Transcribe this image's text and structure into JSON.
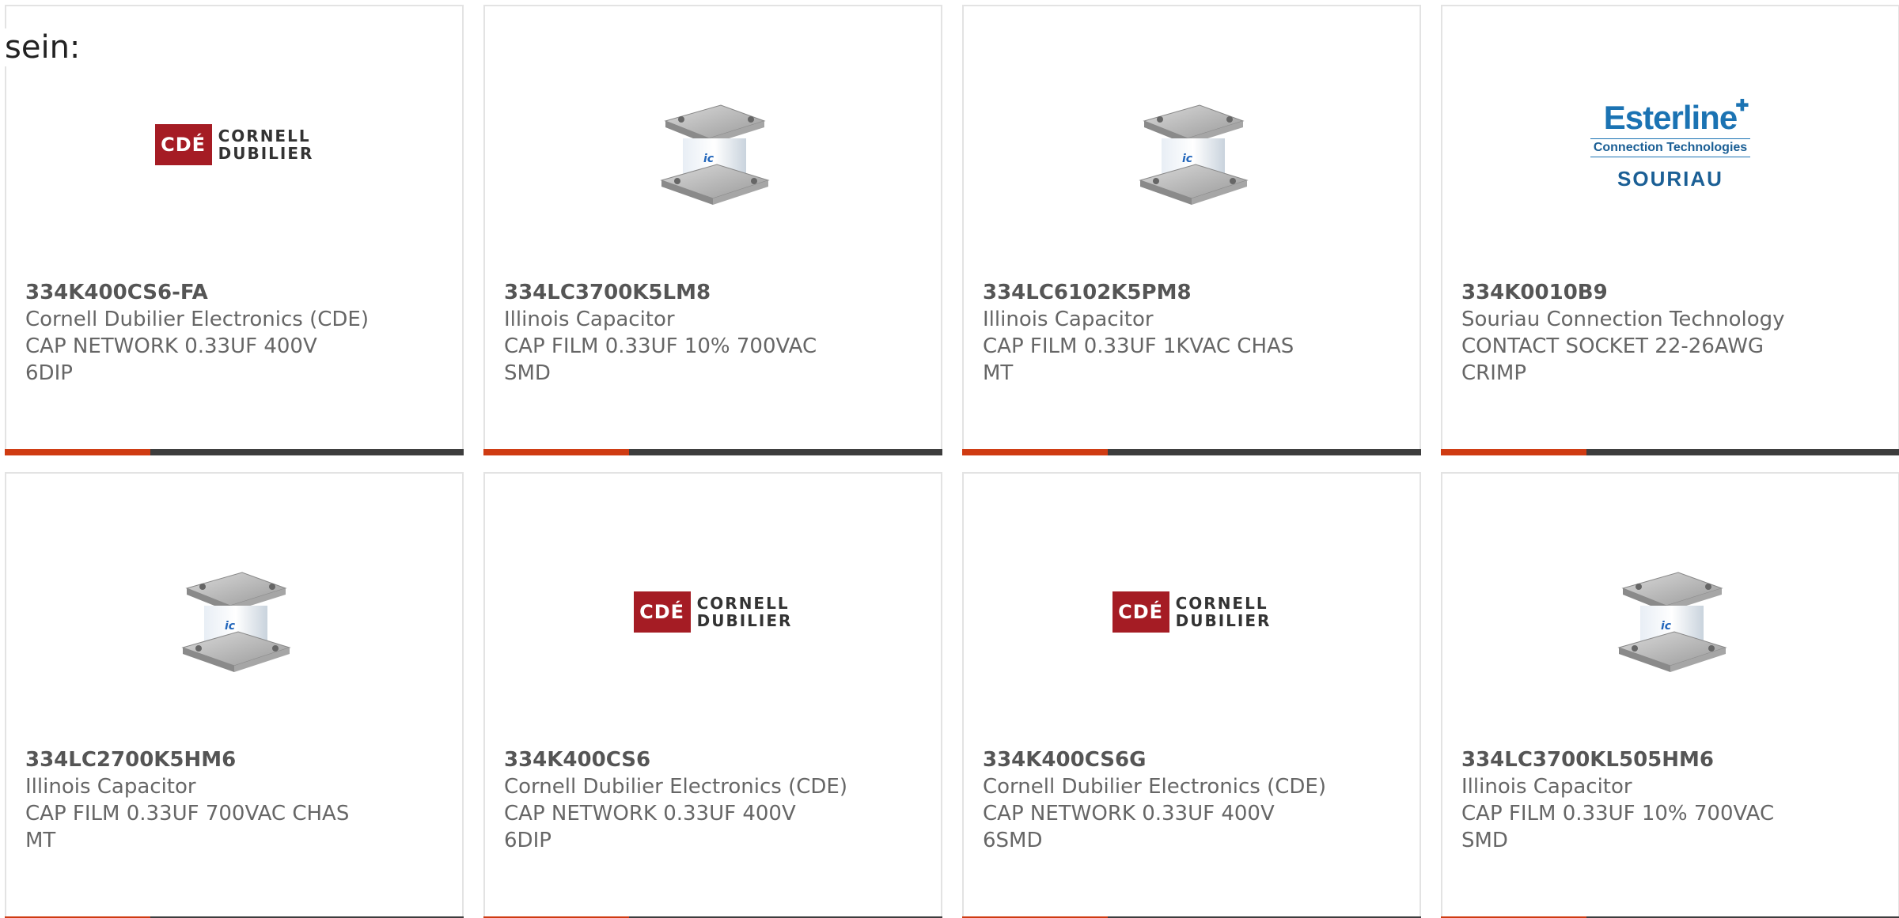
{
  "overlay_text": "sein:",
  "colors": {
    "accent": "#cf3b12",
    "bar_dark": "#3d3d3d",
    "card_border": "#e3e3e3",
    "text": "#666666"
  },
  "cards": [
    {
      "part_number": "334K400CS6-FA",
      "manufacturer": "Cornell Dubilier Electronics (CDE)",
      "desc_line1": "CAP NETWORK 0.33UF 400V",
      "desc_line2": "6DIP",
      "image": "cde-logo",
      "logo_word1": "CORNELL",
      "logo_word2": "DUBILIER",
      "logo_mark": "CDÉ"
    },
    {
      "part_number": "334LC3700K5LM8",
      "manufacturer": "Illinois Capacitor",
      "desc_line1": "CAP FILM 0.33UF 10% 700VAC",
      "desc_line2": "SMD",
      "image": "capacitor-photo"
    },
    {
      "part_number": "334LC6102K5PM8",
      "manufacturer": "Illinois Capacitor",
      "desc_line1": "CAP FILM 0.33UF 1KVAC CHAS",
      "desc_line2": "MT",
      "image": "capacitor-photo"
    },
    {
      "part_number": "334K0010B9",
      "manufacturer": "Souriau Connection Technology",
      "desc_line1": "CONTACT SOCKET 22-26AWG",
      "desc_line2": "CRIMP",
      "image": "esterline-logo",
      "logo_name": "Esterline",
      "logo_tag": "Connection Technologies",
      "logo_sub": "SOURIAU"
    },
    {
      "part_number": "334LC2700K5HM6",
      "manufacturer": "Illinois Capacitor",
      "desc_line1": "CAP FILM 0.33UF 700VAC CHAS",
      "desc_line2": "MT",
      "image": "capacitor-photo"
    },
    {
      "part_number": "334K400CS6",
      "manufacturer": "Cornell Dubilier Electronics (CDE)",
      "desc_line1": "CAP NETWORK 0.33UF 400V",
      "desc_line2": "6DIP",
      "image": "cde-logo",
      "logo_word1": "CORNELL",
      "logo_word2": "DUBILIER",
      "logo_mark": "CDÉ"
    },
    {
      "part_number": "334K400CS6G",
      "manufacturer": "Cornell Dubilier Electronics (CDE)",
      "desc_line1": "CAP NETWORK 0.33UF 400V",
      "desc_line2": "6SMD",
      "image": "cde-logo",
      "logo_word1": "CORNELL",
      "logo_word2": "DUBILIER",
      "logo_mark": "CDÉ"
    },
    {
      "part_number": "334LC3700KL505HM6",
      "manufacturer": "Illinois Capacitor",
      "desc_line1": "CAP FILM 0.33UF 10% 700VAC",
      "desc_line2": "SMD",
      "image": "capacitor-photo"
    }
  ]
}
